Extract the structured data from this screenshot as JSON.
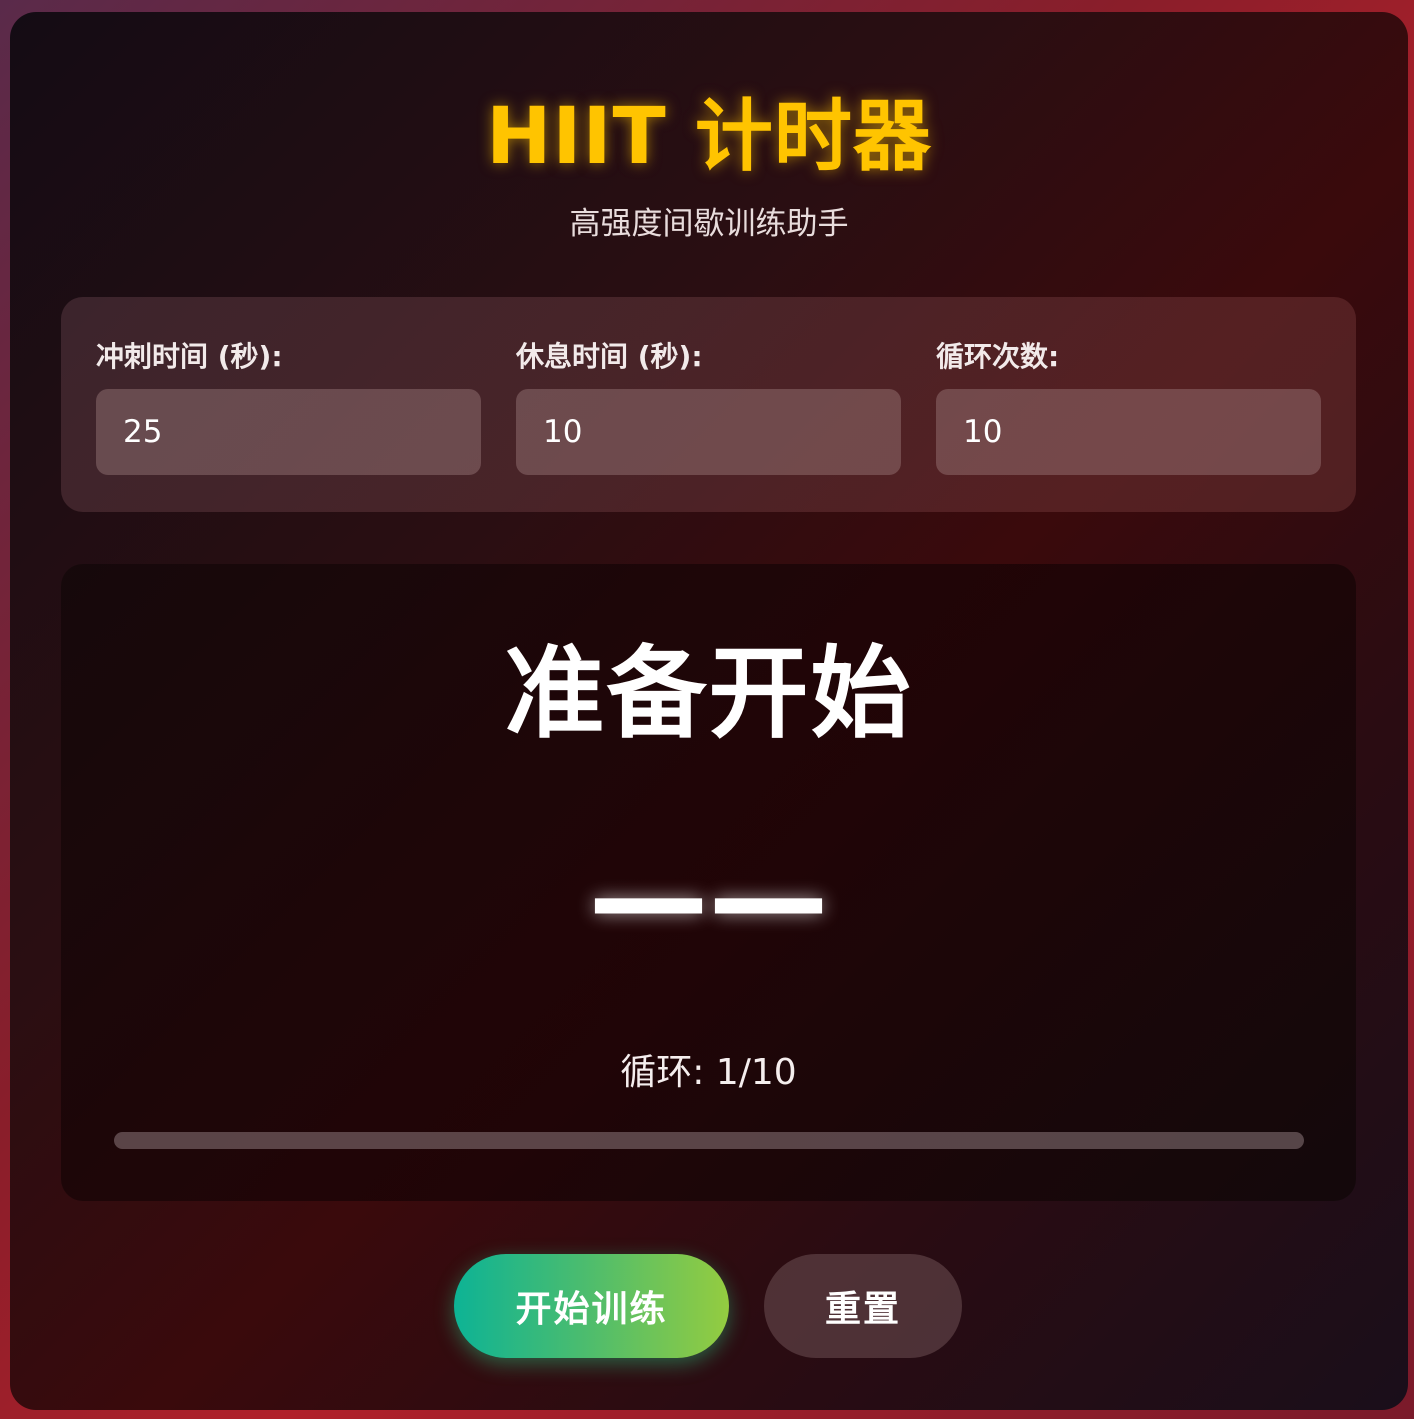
{
  "header": {
    "title": "HIIT 计时器",
    "subtitle": "高强度间歇训练助手"
  },
  "settings": {
    "sprint_label": "冲刺时间 (秒):",
    "sprint_value": "25",
    "rest_label": "休息时间 (秒):",
    "rest_value": "10",
    "cycles_label": "循环次数:",
    "cycles_value": "10"
  },
  "display": {
    "phase": "准备开始",
    "timer": "——",
    "cycle_text": "循环: 1/10",
    "progress_fraction": 0
  },
  "buttons": {
    "start_label": "开始训练",
    "reset_label": "重置"
  },
  "colors": {
    "accent_title": "#ffc400",
    "start_gradient_from": "#0db395",
    "start_gradient_to": "#94cc40"
  }
}
